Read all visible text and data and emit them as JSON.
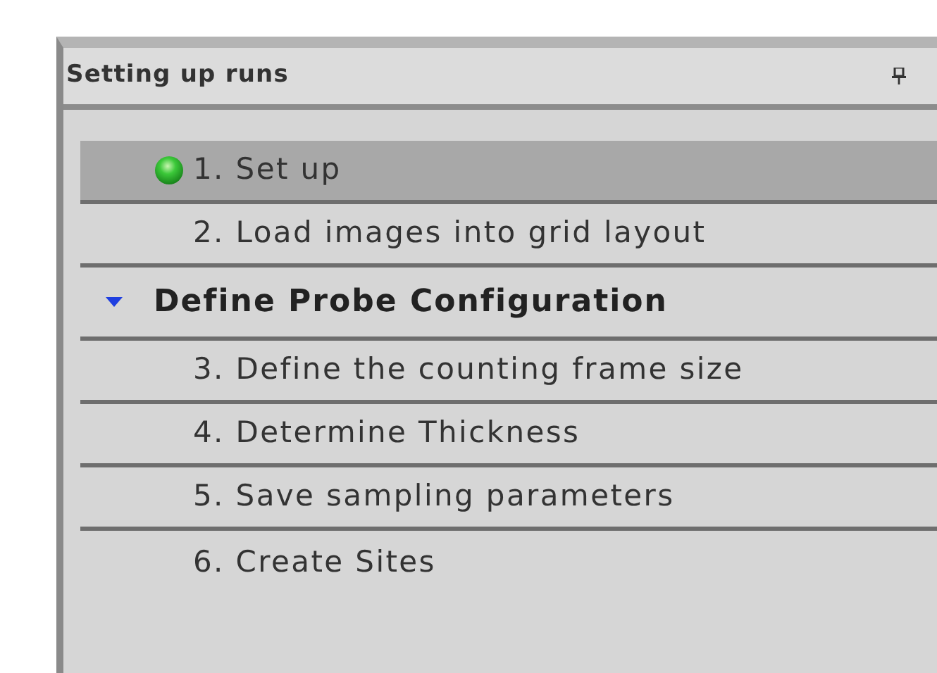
{
  "panel": {
    "title": "Setting up runs",
    "items": [
      {
        "kind": "step",
        "label": "1. Set up",
        "selected": true,
        "done": true
      },
      {
        "kind": "step",
        "label": "2. Load images into grid layout",
        "selected": false,
        "done": false
      },
      {
        "kind": "group",
        "label": "Define Probe Configuration",
        "expanded": true,
        "children": [
          {
            "kind": "step",
            "label": "3. Define the counting frame size",
            "selected": false,
            "done": false
          },
          {
            "kind": "step",
            "label": "4. Determine Thickness",
            "selected": false,
            "done": false
          },
          {
            "kind": "step",
            "label": "5. Save sampling parameters",
            "selected": false,
            "done": false
          },
          {
            "kind": "step",
            "label": "6. Create Sites",
            "selected": false,
            "done": false
          }
        ]
      }
    ]
  }
}
